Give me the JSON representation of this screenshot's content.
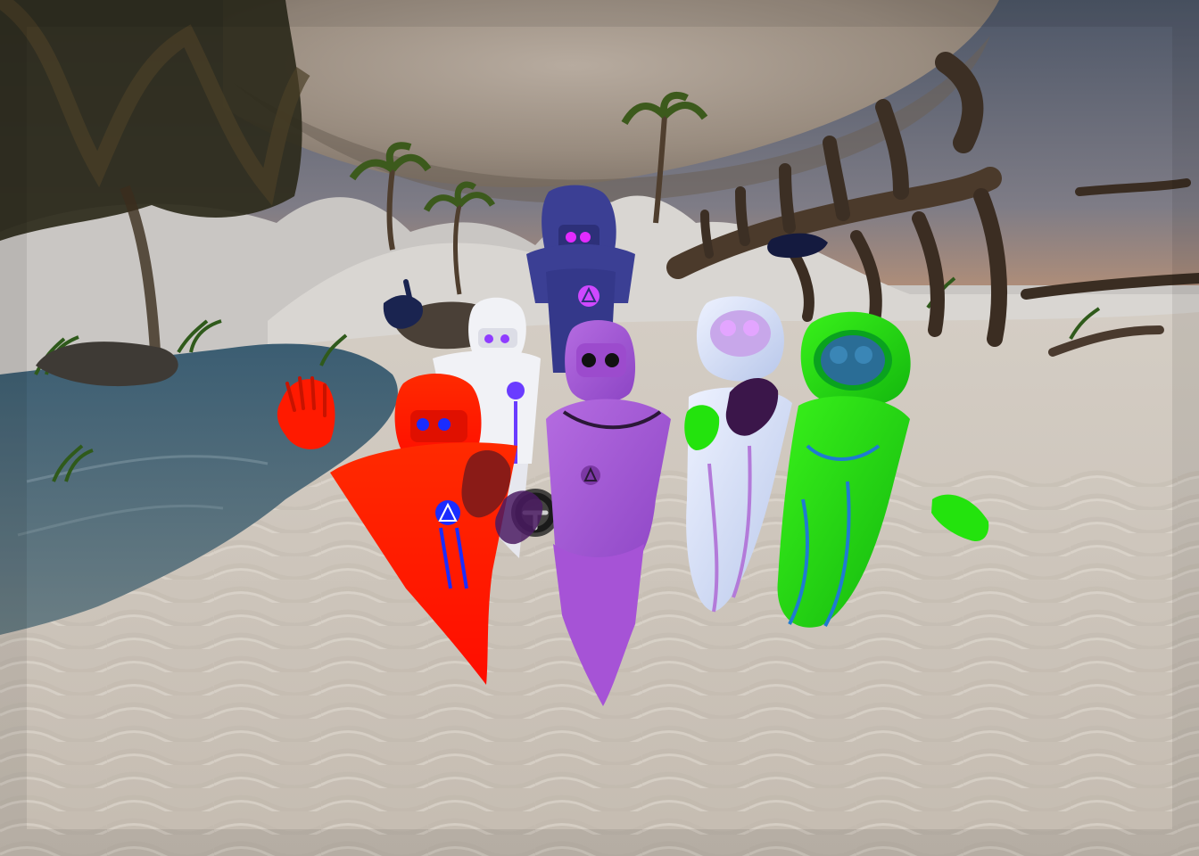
{
  "scene": {
    "description_visible_text": "",
    "palette": {
      "sky_top": "#4f5a6a",
      "sky_glow": "#e7a063",
      "cloud": "#a4978a",
      "sand": "#d8d2ca",
      "sand_shadow": "#b7afa5",
      "water": "#466576",
      "palm": "#2f4a1a",
      "bone": "#5b4a3c"
    }
  },
  "avatars": [
    {
      "id": "red",
      "body": "#ff1a00",
      "visor": "#e01000",
      "eyes": "#1a2cff",
      "emblem": "#1a2cff"
    },
    {
      "id": "white",
      "body": "#f1f2f6",
      "visor": "#dcdde6",
      "eyes": "#8f3cff",
      "emblem": "#6a3cff"
    },
    {
      "id": "navy",
      "body": "#3b3f94",
      "visor": "#2d3079",
      "eyes": "#e22bff",
      "emblem": "#cf48ff"
    },
    {
      "id": "purple",
      "body": "#b163dd",
      "visor": "#9c4bcd",
      "eyes": "#111111",
      "emblem": "#6a2a8e"
    },
    {
      "id": "lavender",
      "body": "#d7def3",
      "visor": "#c8a7ea",
      "eyes": "#e3a5ff",
      "emblem": "#b37ad9"
    },
    {
      "id": "green",
      "body": "#23e30d",
      "visor": "#0aa21f",
      "eyes": "#2a6d96",
      "emblem": "#1f7bd1"
    }
  ],
  "ui": {
    "teleport_icon": "teleport-reticle-icon"
  }
}
